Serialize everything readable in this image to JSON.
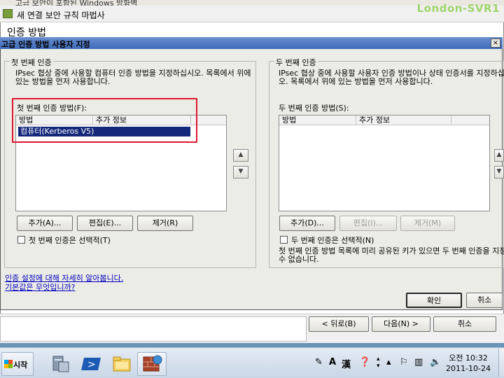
{
  "watermark": "London-SVR1",
  "background_window": {
    "title": "고급 보안이 포함된 Windows 방화벽"
  },
  "wizard": {
    "title": "새 연결 보안 규칙 마법사",
    "section": "인증 방법",
    "back_label": "< 뒤로(B)",
    "next_label": "다음(N) >",
    "cancel_label": "취소"
  },
  "dialog": {
    "title": "고급 인증 방법 사용자 지정",
    "close": "×",
    "first": {
      "group_title": "첫 번째 인증",
      "description": "IPsec 협상 중에 사용할 컴퓨터 인증 방법을 지정하십시오. 목록에서 위에 있는 방법을 먼저 사용합니다.",
      "list_label": "첫 번째 인증 방법(F):",
      "columns": [
        "방법",
        "추가 정보"
      ],
      "rows": [
        [
          "컴퓨터(Kerberos V5)",
          ""
        ]
      ],
      "add_label": "추가(A)...",
      "edit_label": "편집(E)...",
      "remove_label": "제거(R)",
      "optional_label": "첫 번째 인증은 선택적(T)",
      "optional_checked": false
    },
    "second": {
      "group_title": "두 번째 인증",
      "description": "IPsec 협상 중에 사용할 사용자 인증 방법이나 상태 인증서를 지정하십시오. 목록에서 위에 있는 방법을 먼저 사용합니다.",
      "list_label": "두 번째 인증 방법(S):",
      "columns": [
        "방법",
        "추가 정보"
      ],
      "rows": [],
      "add_label": "추가(D)...",
      "edit_label": "편집(I)...",
      "remove_label": "제거(M)",
      "optional_label": "두 번째 인증은 선택적(N)",
      "optional_checked": false,
      "note": "첫 번째 인증 방법 목록에 미리 공유된 키가 있으면 두 번째 인증을 지정할 수 없습니다."
    },
    "link_learn": "인증 설정에 대해 자세히 알아봅니다.",
    "link_defaults": "기본값은 무엇입니까?",
    "ok_label": "확인",
    "cancel_label": "취소"
  },
  "taskbar": {
    "start_label": "시작",
    "ime_lang": "A",
    "ime_hanja": "漢",
    "clock_time": "오전 10:32",
    "clock_date": "2011-10-24"
  }
}
